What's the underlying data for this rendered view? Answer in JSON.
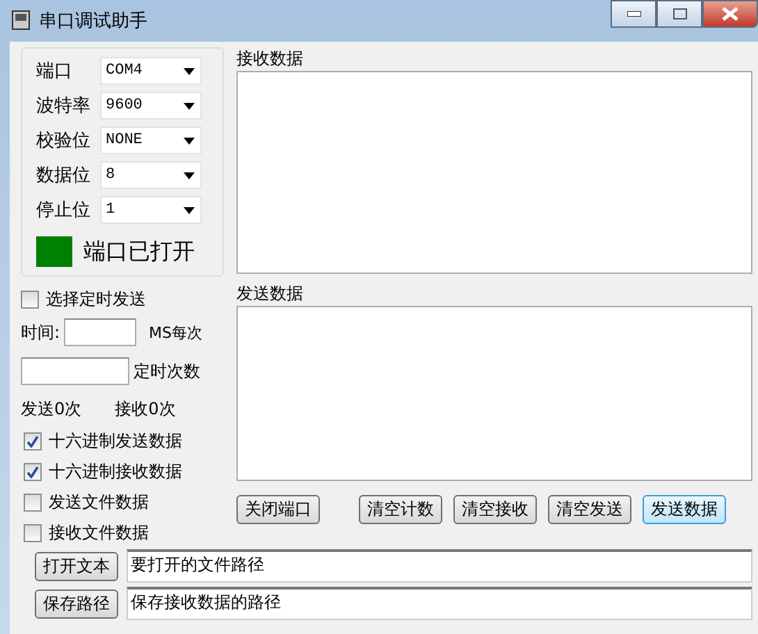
{
  "window": {
    "title": "串口调试助手"
  },
  "settings": [
    {
      "label": "端口",
      "value": "COM4"
    },
    {
      "label": "波特率",
      "value": "9600"
    },
    {
      "label": "校验位",
      "value": "NONE"
    },
    {
      "label": "数据位",
      "value": "8"
    },
    {
      "label": "停止位",
      "value": "1"
    }
  ],
  "port_status": {
    "open": true,
    "text": "端口已打开"
  },
  "timed_send": {
    "label": "选择定时发送",
    "checked": false
  },
  "interval": {
    "label": "时间:",
    "unit": "MS每次"
  },
  "repeat": {
    "label": "定时次数"
  },
  "counters": [
    "发送0次",
    "接收0次"
  ],
  "options": [
    {
      "label": "十六进制发送数据",
      "checked": true
    },
    {
      "label": "十六进制接收数据",
      "checked": true
    },
    {
      "label": "发送文件数据",
      "checked": false
    },
    {
      "label": "接收文件数据",
      "checked": false
    }
  ],
  "receive": {
    "label": "接收数据"
  },
  "send": {
    "label": "发送数据"
  },
  "buttons": [
    {
      "label": "关闭端口",
      "focused": false
    },
    {
      "label": "清空计数",
      "focused": false
    },
    {
      "label": "清空接收",
      "focused": false
    },
    {
      "label": "清空发送",
      "focused": false
    },
    {
      "label": "发送数据",
      "focused": true
    }
  ],
  "files": [
    {
      "button": "打开文本",
      "path": "要打开的文件路径"
    },
    {
      "button": "保存路径",
      "path": "保存接收数据的路径"
    }
  ]
}
